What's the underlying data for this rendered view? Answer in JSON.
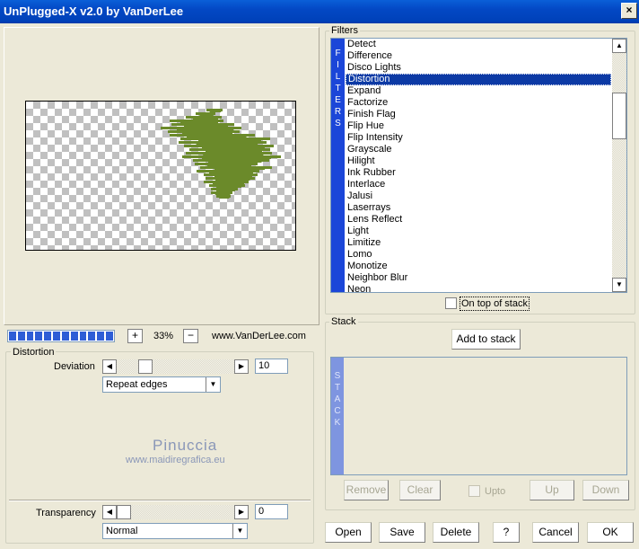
{
  "window": {
    "title": "UnPlugged-X v2.0 by VanDerLee",
    "close_label": "×"
  },
  "zoom": {
    "plus": "+",
    "value": "33%",
    "minus": "−",
    "site": "www.VanDerLee.com"
  },
  "distortion": {
    "group_title": "Distortion",
    "deviation_label": "Deviation",
    "deviation_value": "10",
    "edge_mode": "Repeat edges"
  },
  "watermark": {
    "line1": "Pinuccia",
    "line2": "www.maidiregrafica.eu"
  },
  "transparency": {
    "label": "Transparency",
    "value": "0",
    "blend_mode": "Normal"
  },
  "filters": {
    "group_title": "Filters",
    "vertical_label": [
      "F",
      "I",
      "L",
      "T",
      "E",
      "R",
      "S"
    ],
    "items": [
      "Detect",
      "Difference",
      "Disco Lights",
      "Distortion",
      "Expand",
      "Factorize",
      "Finish Flag",
      "Flip Hue",
      "Flip Intensity",
      "Grayscale",
      "Hilight",
      "Ink Rubber",
      "Interlace",
      "Jalusi",
      "Laserrays",
      "Lens Reflect",
      "Light",
      "Limitize",
      "Lomo",
      "Monotize",
      "Neighbor Blur",
      "Neon"
    ],
    "selected_index": 3,
    "on_top_label": "On top of stack"
  },
  "stack": {
    "group_title": "Stack",
    "add_label": "Add to stack",
    "vertical_label": [
      "S",
      "T",
      "A",
      "C",
      "K"
    ],
    "remove_label": "Remove",
    "clear_label": "Clear",
    "upto_label": "Upto",
    "up_label": "Up",
    "down_label": "Down"
  },
  "footer": {
    "open": "Open",
    "save": "Save",
    "delete": "Delete",
    "help": "?",
    "cancel": "Cancel",
    "ok": "OK"
  },
  "colors": {
    "title_bar": "#0348c4",
    "filters_strip": "#1b46d8",
    "selection": "#0c3aa5",
    "preview_shape": "#6b8a2a"
  }
}
